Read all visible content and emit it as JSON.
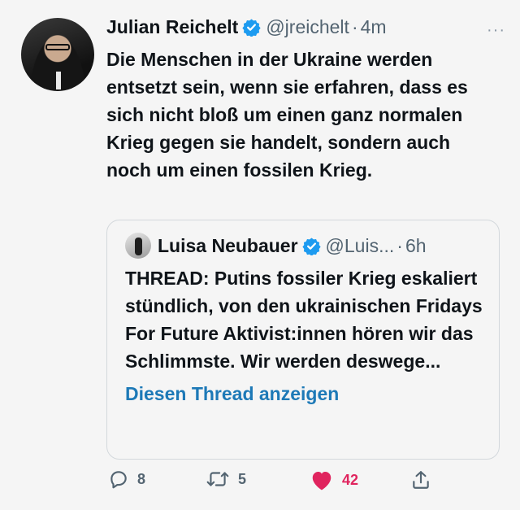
{
  "tweet": {
    "author_name": "Julian Reichelt",
    "handle": "@jreichelt",
    "separator": "·",
    "time": "4m",
    "more": "···",
    "text": "Die Menschen in der Ukraine werden entsetzt sein, wenn sie erfahren, dass es sich nicht bloß um einen ganz normalen Krieg gegen sie handelt, sondern auch noch um einen fossilen Krieg."
  },
  "quoted": {
    "author_name": "Luisa Neubauer",
    "handle": "@Luis...",
    "separator": "·",
    "time": "6h",
    "text": "THREAD: Putins fossiler Krieg eskaliert stündlich, von den ukrainischen Fridays For Future Aktivist:innen hören wir das Schlimmste. Wir werden deswege...",
    "show_thread_link": "Diesen Thread anzeigen"
  },
  "actions": {
    "replies": "8",
    "retweets": "5",
    "likes": "42"
  },
  "colors": {
    "verified": "#1d9bf0",
    "link": "#1d79b7",
    "like": "#e0245e",
    "muted": "#536471"
  },
  "icons": [
    "verified-badge-icon",
    "more-icon",
    "reply-icon",
    "retweet-icon",
    "heart-icon",
    "share-icon"
  ]
}
